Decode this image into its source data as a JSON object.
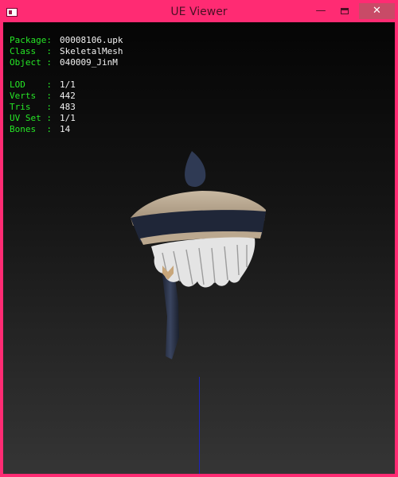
{
  "window": {
    "title": "UE Viewer",
    "controls": {
      "minimize": "—",
      "close": "✕"
    }
  },
  "info": {
    "object_rows": [
      {
        "label": "Package:",
        "value": "00008106.upk"
      },
      {
        "label": "Class  :",
        "value": "SkeletalMesh"
      },
      {
        "label": "Object :",
        "value": "040009_JinM"
      }
    ],
    "mesh_rows": [
      {
        "label": "LOD    :",
        "value": "1/1"
      },
      {
        "label": "Verts  :",
        "value": "442"
      },
      {
        "label": "Tris   :",
        "value": "483"
      },
      {
        "label": "UV Set :",
        "value": "1/1"
      },
      {
        "label": "Bones  :",
        "value": "14"
      }
    ]
  },
  "colors": {
    "frame": "#ff2b73",
    "label_text": "#26e626",
    "value_text": "#f2f2f2",
    "axis": "#1b22c2"
  }
}
